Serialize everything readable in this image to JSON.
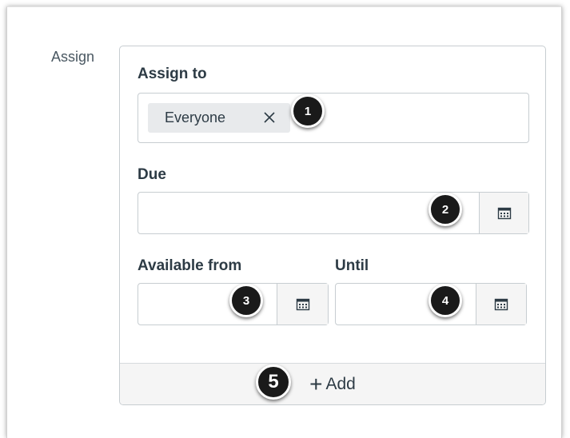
{
  "section_label": "Assign",
  "assign_to": {
    "label": "Assign to",
    "selected_pill": "Everyone"
  },
  "due": {
    "label": "Due",
    "value": ""
  },
  "available_from": {
    "label": "Available from",
    "value": ""
  },
  "until": {
    "label": "Until",
    "value": ""
  },
  "add_button": {
    "label": "Add"
  },
  "callouts": [
    "1",
    "2",
    "3",
    "4",
    "5"
  ],
  "icons": {
    "remove": "close-icon",
    "calendar": "calendar-icon",
    "add": "plus-icon"
  }
}
